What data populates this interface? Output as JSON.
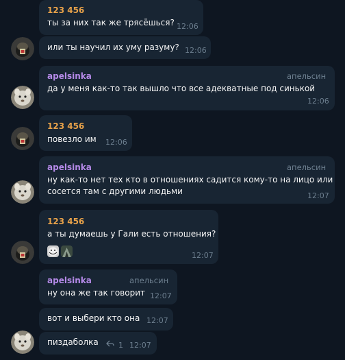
{
  "messages": {
    "m1": {
      "sender": "123 456",
      "text": "ты за них так же трясёшься?",
      "time": "12:06"
    },
    "m2": {
      "text": "или ты научил их уму разуму?",
      "time": "12:06"
    },
    "m3": {
      "sender": "apelsinka",
      "rank": "апельсин",
      "text": "да у меня как-то так вышло что все адекватные под синькой",
      "time": "12:06"
    },
    "m4": {
      "sender": "123 456",
      "text": "повезло им",
      "time": "12:06"
    },
    "m5": {
      "sender": "apelsinka",
      "rank": "апельсин",
      "line1": "ну как-то нет тех кто в отношениях садится кому-то на лицо или",
      "line2": "сосется там с другими людьми",
      "time": "12:07"
    },
    "m6": {
      "sender": "123 456",
      "text": "а ты думаешь у Гали есть отношения?",
      "time": "12:07"
    },
    "m7": {
      "sender": "apelsinka",
      "rank": "апельсин",
      "text": "ну она же так говорит",
      "time": "12:07"
    },
    "m8": {
      "text": "вот и выбери кто она",
      "time": "12:07"
    },
    "m9": {
      "text": "пиздаболка",
      "time": "12:07",
      "reply_count": "1"
    }
  },
  "colors": {
    "background": "#0e1621",
    "bubble": "#182533",
    "sender_orange": "#e8a24a",
    "sender_purple": "#b58ae8",
    "meta_gray": "#6d7f8f"
  },
  "icons": {
    "reply": "reply-arrow-icon"
  }
}
